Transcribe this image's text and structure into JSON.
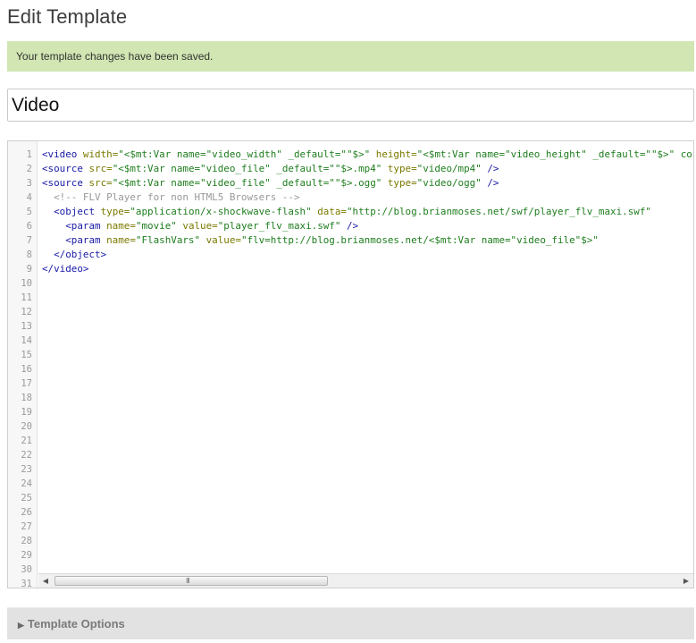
{
  "page": {
    "title": "Edit Template"
  },
  "message": {
    "text": "Your template changes have been saved."
  },
  "template": {
    "name": "Video"
  },
  "editor": {
    "line_numbers": [
      "1",
      "2",
      "3",
      "4",
      "5",
      "6",
      "7",
      "8",
      "9",
      "10",
      "11",
      "12",
      "13",
      "14",
      "15",
      "16",
      "17",
      "18",
      "19",
      "20",
      "21",
      "22",
      "23",
      "24",
      "25",
      "26",
      "27",
      "28",
      "29",
      "30",
      "31"
    ],
    "code_lines": [
      [
        [
          "t",
          "<video "
        ],
        [
          "a",
          "width="
        ],
        [
          "s",
          "\"<$mt:Var name=\"video_width\" _default=\"\"$>\""
        ],
        [
          "a",
          " height="
        ],
        [
          "s",
          "\"<$mt:Var name=\"video_height\" _default=\"\"$>\" controls>"
        ]
      ],
      [
        [
          "t",
          "<source "
        ],
        [
          "a",
          "src="
        ],
        [
          "s",
          "\"<$mt:Var name=\"video_file\" _default=\"\"$>.mp4\""
        ],
        [
          "a",
          " type="
        ],
        [
          "s",
          "\"video/mp4\""
        ],
        [
          "t",
          " />"
        ]
      ],
      [
        [
          "t",
          "<source "
        ],
        [
          "a",
          "src="
        ],
        [
          "s",
          "\"<$mt:Var name=\"video_file\" _default=\"\"$>.ogg\""
        ],
        [
          "a",
          " type="
        ],
        [
          "s",
          "\"video/ogg\""
        ],
        [
          "t",
          " />"
        ]
      ],
      [
        [
          "c",
          "  <!-- FLV Player for non HTML5 Browsers -->"
        ]
      ],
      [
        [
          "t",
          "  <object "
        ],
        [
          "a",
          "type="
        ],
        [
          "s",
          "\"application/x-shockwave-flash\""
        ],
        [
          "a",
          " data="
        ],
        [
          "s",
          "\"http://blog.brianmoses.net/swf/player_flv_maxi.swf\""
        ]
      ],
      [
        [
          "t",
          "    <param "
        ],
        [
          "a",
          "name="
        ],
        [
          "s",
          "\"movie\""
        ],
        [
          "a",
          " value="
        ],
        [
          "s",
          "\"player_flv_maxi.swf\""
        ],
        [
          "t",
          " />"
        ]
      ],
      [
        [
          "t",
          "    <param "
        ],
        [
          "a",
          "name="
        ],
        [
          "s",
          "\"FlashVars\""
        ],
        [
          "a",
          " value="
        ],
        [
          "s",
          "\"flv=http://blog.brianmoses.net/<$mt:Var name=\"video_file\"$>\""
        ]
      ],
      [
        [
          "t",
          "  </object>"
        ]
      ],
      [
        [
          "t",
          "</video>"
        ]
      ]
    ],
    "scroll_grip": "III"
  },
  "options": {
    "label": "Template Options",
    "arrow": "▶"
  }
}
